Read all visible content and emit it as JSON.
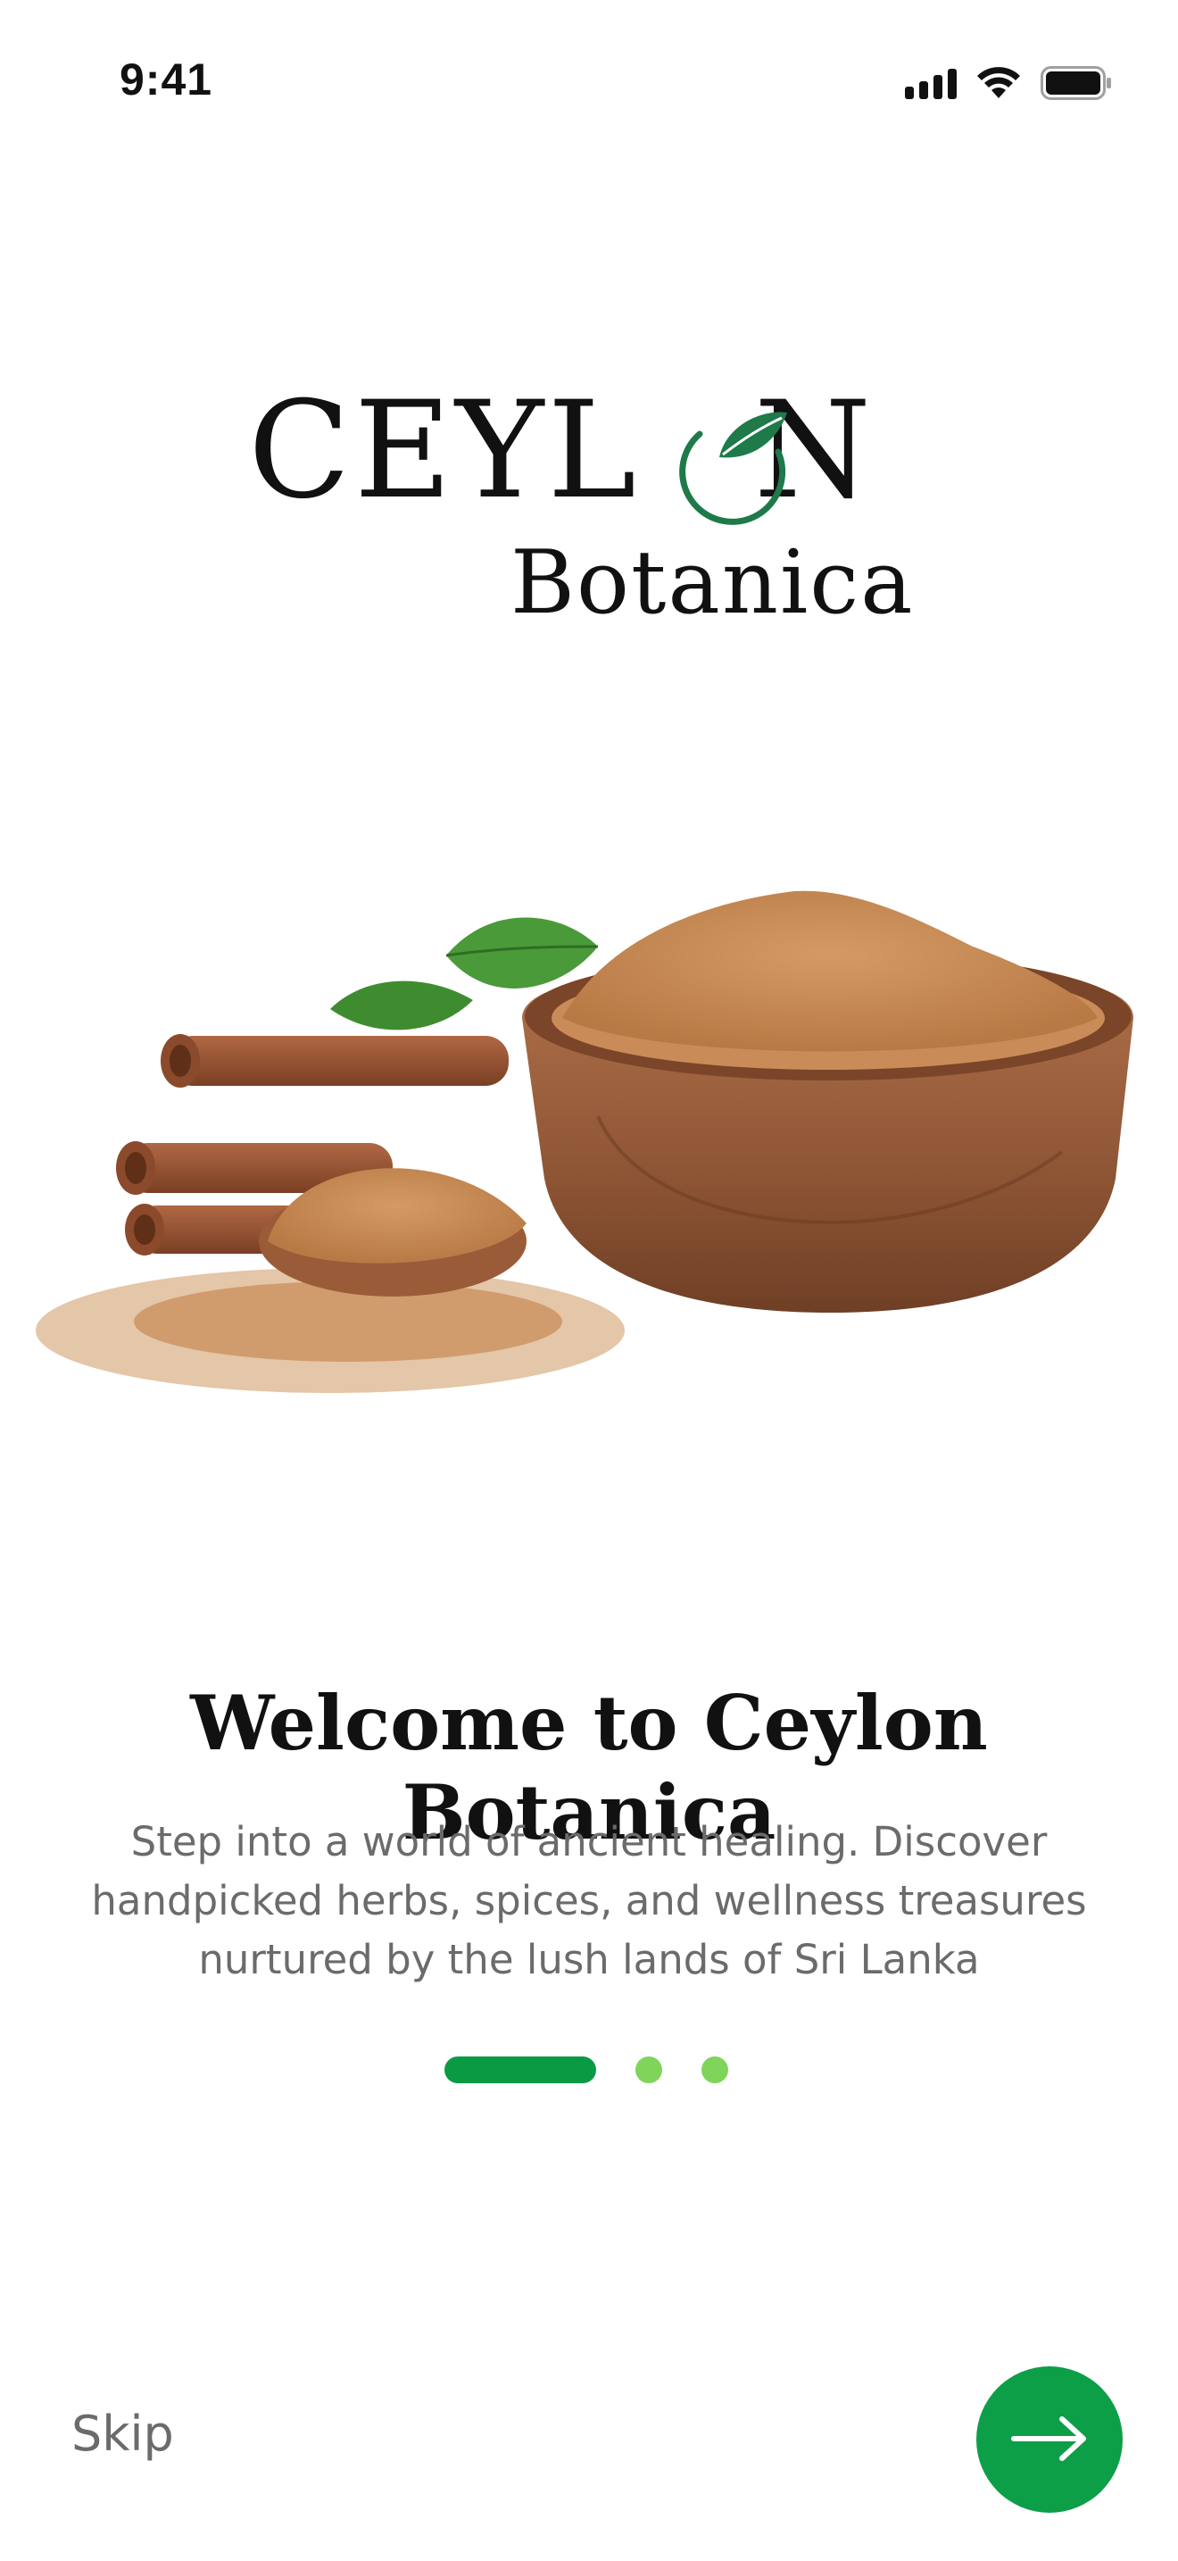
{
  "status_bar": {
    "time": "9:41",
    "icons": [
      "signal-icon",
      "wifi-icon",
      "battery-icon"
    ]
  },
  "logo": {
    "word_part1": "CEYL",
    "word_part2": "N",
    "subtitle": "Botanica",
    "leaf_color": "#1f7a4a"
  },
  "hero": {
    "description": "cinnamon sticks, cinnamon powder in wooden bowl and spoon, green leaves"
  },
  "onboarding": {
    "title": "Welcome to Ceylon Botanica",
    "description": "Step into a world of ancient healing. Discover handpicked herbs, spices, and wellness treasures nurtured by the lush lands of Sri Lanka",
    "page_count": 3,
    "current_page": 1
  },
  "controls": {
    "skip_label": "Skip",
    "next_icon": "arrow-right-icon"
  },
  "colors": {
    "primary": "#0d9e48",
    "pager_active": "#0b9a44",
    "pager_inactive": "#7fd45a",
    "text_muted": "#6b6b6b"
  }
}
